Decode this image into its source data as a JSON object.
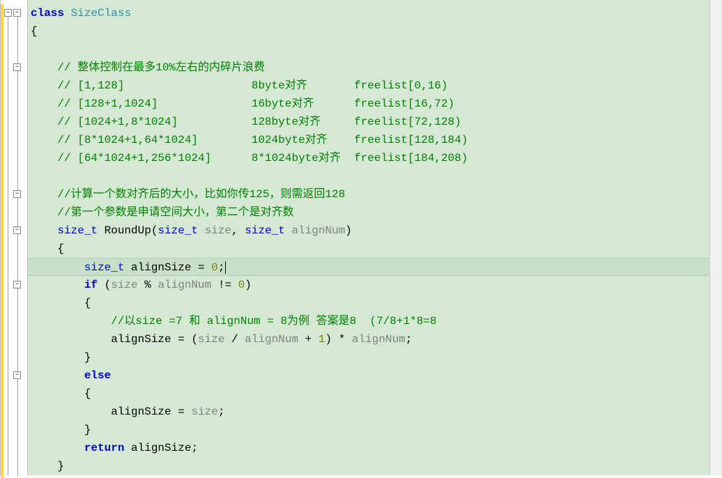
{
  "code": {
    "lines": [
      {
        "indent": 0,
        "segments": [
          {
            "cls": "kw",
            "t": "class"
          },
          {
            "cls": "",
            "t": " "
          },
          {
            "cls": "class-name",
            "t": "SizeClass"
          }
        ]
      },
      {
        "indent": 0,
        "segments": [
          {
            "cls": "",
            "t": "{"
          }
        ]
      },
      {
        "indent": 0,
        "segments": []
      },
      {
        "indent": 3,
        "segments": [
          {
            "cls": "comment",
            "t": "// 整体控制在最多10%左右的内碎片浪费"
          }
        ]
      },
      {
        "indent": 3,
        "segments": [
          {
            "cls": "comment",
            "t": "// [1,128]                   8byte对齐       freelist[0,16)"
          }
        ]
      },
      {
        "indent": 3,
        "segments": [
          {
            "cls": "comment",
            "t": "// [128+1,1024]              16byte对齐      freelist[16,72)"
          }
        ]
      },
      {
        "indent": 3,
        "segments": [
          {
            "cls": "comment",
            "t": "// [1024+1,8*1024]           128byte对齐     freelist[72,128)"
          }
        ]
      },
      {
        "indent": 3,
        "segments": [
          {
            "cls": "comment",
            "t": "// [8*1024+1,64*1024]        1024byte对齐    freelist[128,184)"
          }
        ]
      },
      {
        "indent": 3,
        "segments": [
          {
            "cls": "comment",
            "t": "// [64*1024+1,256*1024]      8*1024byte对齐  freelist[184,208)"
          }
        ]
      },
      {
        "indent": 0,
        "segments": []
      },
      {
        "indent": 3,
        "segments": [
          {
            "cls": "comment",
            "t": "//计算一个数对齐后的大小，比如你传125，则需返回128"
          }
        ]
      },
      {
        "indent": 3,
        "segments": [
          {
            "cls": "comment",
            "t": "//第一个参数是申请空间大小，第二个是对齐数"
          }
        ]
      },
      {
        "indent": 3,
        "segments": [
          {
            "cls": "type",
            "t": "size_t"
          },
          {
            "cls": "",
            "t": " RoundUp("
          },
          {
            "cls": "type",
            "t": "size_t"
          },
          {
            "cls": "",
            "t": " "
          },
          {
            "cls": "identifier",
            "t": "size"
          },
          {
            "cls": "",
            "t": ", "
          },
          {
            "cls": "type",
            "t": "size_t"
          },
          {
            "cls": "",
            "t": " "
          },
          {
            "cls": "identifier",
            "t": "alignNum"
          },
          {
            "cls": "",
            "t": ")"
          }
        ]
      },
      {
        "indent": 3,
        "segments": [
          {
            "cls": "",
            "t": "{"
          }
        ]
      },
      {
        "indent": 5,
        "segments": [
          {
            "cls": "type",
            "t": "size_t"
          },
          {
            "cls": "",
            "t": " alignSize = "
          },
          {
            "cls": "literal",
            "t": "0"
          },
          {
            "cls": "",
            "t": ";"
          }
        ],
        "highlighted": true,
        "cursor": true
      },
      {
        "indent": 5,
        "segments": [
          {
            "cls": "kw",
            "t": "if"
          },
          {
            "cls": "",
            "t": " ("
          },
          {
            "cls": "identifier",
            "t": "size"
          },
          {
            "cls": "",
            "t": " % "
          },
          {
            "cls": "identifier",
            "t": "alignNum"
          },
          {
            "cls": "",
            "t": " != "
          },
          {
            "cls": "literal",
            "t": "0"
          },
          {
            "cls": "",
            "t": ")"
          }
        ]
      },
      {
        "indent": 5,
        "segments": [
          {
            "cls": "",
            "t": "{"
          }
        ]
      },
      {
        "indent": 7,
        "segments": [
          {
            "cls": "comment",
            "t": "//以size =7 和 alignNum = 8为例 答案是8  (7/8+1*8=8"
          }
        ]
      },
      {
        "indent": 7,
        "segments": [
          {
            "cls": "",
            "t": "alignSize = ("
          },
          {
            "cls": "identifier",
            "t": "size"
          },
          {
            "cls": "",
            "t": " / "
          },
          {
            "cls": "identifier",
            "t": "alignNum"
          },
          {
            "cls": "",
            "t": " + "
          },
          {
            "cls": "literal",
            "t": "1"
          },
          {
            "cls": "",
            "t": ") * "
          },
          {
            "cls": "identifier",
            "t": "alignNum"
          },
          {
            "cls": "",
            "t": ";"
          }
        ]
      },
      {
        "indent": 5,
        "segments": [
          {
            "cls": "",
            "t": "}"
          }
        ]
      },
      {
        "indent": 5,
        "segments": [
          {
            "cls": "kw",
            "t": "else"
          }
        ]
      },
      {
        "indent": 5,
        "segments": [
          {
            "cls": "",
            "t": "{"
          }
        ]
      },
      {
        "indent": 7,
        "segments": [
          {
            "cls": "",
            "t": "alignSize = "
          },
          {
            "cls": "identifier",
            "t": "size"
          },
          {
            "cls": "",
            "t": ";"
          }
        ]
      },
      {
        "indent": 5,
        "segments": [
          {
            "cls": "",
            "t": "}"
          }
        ]
      },
      {
        "indent": 5,
        "segments": [
          {
            "cls": "kw",
            "t": "return"
          },
          {
            "cls": "",
            "t": " alignSize;"
          }
        ]
      },
      {
        "indent": 3,
        "segments": [
          {
            "cls": "",
            "t": "}"
          }
        ]
      }
    ]
  },
  "fold": {
    "boxes": [
      {
        "line": 0,
        "symbol": "−"
      },
      {
        "line": 3,
        "symbol": "−"
      },
      {
        "line": 10,
        "symbol": "−"
      },
      {
        "line": 12,
        "symbol": "−"
      },
      {
        "line": 15,
        "symbol": "−"
      },
      {
        "line": 20,
        "symbol": "−"
      }
    ]
  }
}
